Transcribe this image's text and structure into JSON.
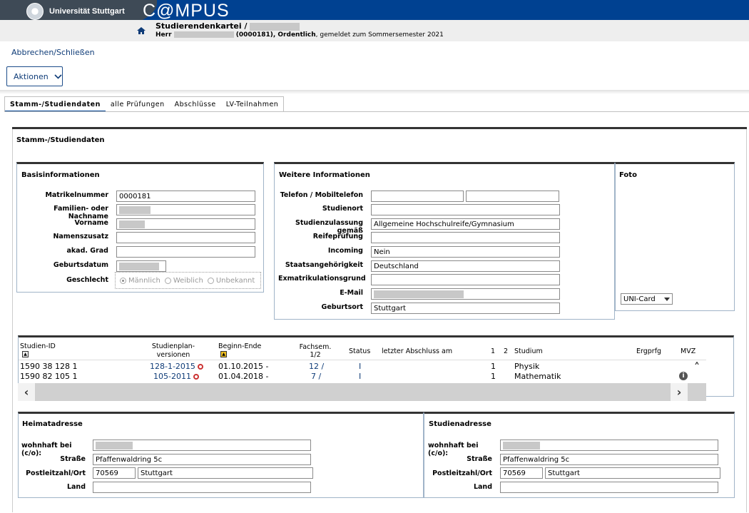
{
  "header": {
    "logo_text": "Universität Stuttgart",
    "app_name": "C@MPUS",
    "page_title": "Studierendenkartei  /",
    "person_prefix": "Herr",
    "person_info": "(0000181), Ordentlich",
    "person_suffix": ", gemeldet zum Sommersemester 2021"
  },
  "toolbar": {
    "cancel_link": "Abbrechen/Schließen",
    "actions_label": "Aktionen"
  },
  "tabs": [
    {
      "label": "Stamm-/Studiendaten",
      "active": true
    },
    {
      "label": "alle Prüfungen",
      "active": false
    },
    {
      "label": "Abschlüsse",
      "active": false
    },
    {
      "label": "LV-Teilnahmen",
      "active": false
    }
  ],
  "main": {
    "title": "Stamm-/Studiendaten",
    "basis": {
      "title": "Basisinformationen",
      "matrikel_label": "Matrikelnummer",
      "matrikel_value": "0000181",
      "nachname_label": "Familien- oder Nachname",
      "vorname_label": "Vorname",
      "namenszusatz_label": "Namenszusatz",
      "grad_label": "akad. Grad",
      "geburtsdatum_label": "Geburtsdatum",
      "geschlecht_label": "Geschlecht",
      "gender_options": [
        "Männlich",
        "Weiblich",
        "Unbekannt"
      ]
    },
    "weitere": {
      "title": "Weitere Informationen",
      "telefon_label": "Telefon / Mobiltelefon",
      "studienort_label": "Studienort",
      "zulassung_label": "Studienzulassung gemäß",
      "zulassung_value": "Allgemeine Hochschulreife/Gymnasium",
      "reife_label": "Reifeprüfung",
      "incoming_label": "Incoming",
      "incoming_value": "Nein",
      "staat_label": "Staatsangehörigkeit",
      "staat_value": "Deutschland",
      "exmat_label": "Exmatrikulationsgrund",
      "email_label": "E-Mail",
      "geburtsort_label": "Geburtsort",
      "geburtsort_value": "Stuttgart"
    },
    "foto": {
      "title": "Foto",
      "select_value": "UNI-Card"
    }
  },
  "studien": {
    "headers": {
      "id": "Studien-ID",
      "plan": "Studienplan-\nversionen",
      "beginn": "Beginn-Ende",
      "fachsem": "Fachsem.\n1/2",
      "status": "Status",
      "abschluss": "letzter Abschluss am",
      "c1": "1",
      "c2": "2",
      "studium": "Studium",
      "ergprfg": "Ergprfg",
      "mvz": "MVZ"
    },
    "rows": [
      {
        "id": "1590 38 128 1",
        "plan": "128-1-2015",
        "beginn": "01.10.2015 -",
        "fachsem": "12 /",
        "status": "I",
        "c1": "1",
        "studium": "Physik"
      },
      {
        "id": "1590 82 105 1",
        "plan": "105-2011",
        "beginn": "01.04.2018 -",
        "fachsem": "7 /",
        "status": "I",
        "c1": "1",
        "studium": "Mathematik"
      }
    ]
  },
  "heimat": {
    "title": "Heimatadresse",
    "co_label": "wohnhaft bei (c/o):",
    "strasse_label": "Straße",
    "strasse_value": "Pfaffenwaldring 5c",
    "plz_label": "Postleitzahl/Ort",
    "plz_value": "70569",
    "ort_value": "Stuttgart",
    "land_label": "Land"
  },
  "studienadresse": {
    "title": "Studienadresse",
    "co_label": "wohnhaft bei (c/o):",
    "strasse_label": "Straße",
    "strasse_value": "Pfaffenwaldring 5c",
    "plz_label": "Postleitzahl/Ort",
    "plz_value": "70569",
    "ort_value": "Stuttgart",
    "land_label": "Land"
  },
  "icons": {
    "home": "home-icon",
    "info": "info-icon",
    "plan_status": "circle-icon"
  },
  "colors": {
    "brand_blue": "#004191",
    "link": "#0f3c78"
  }
}
